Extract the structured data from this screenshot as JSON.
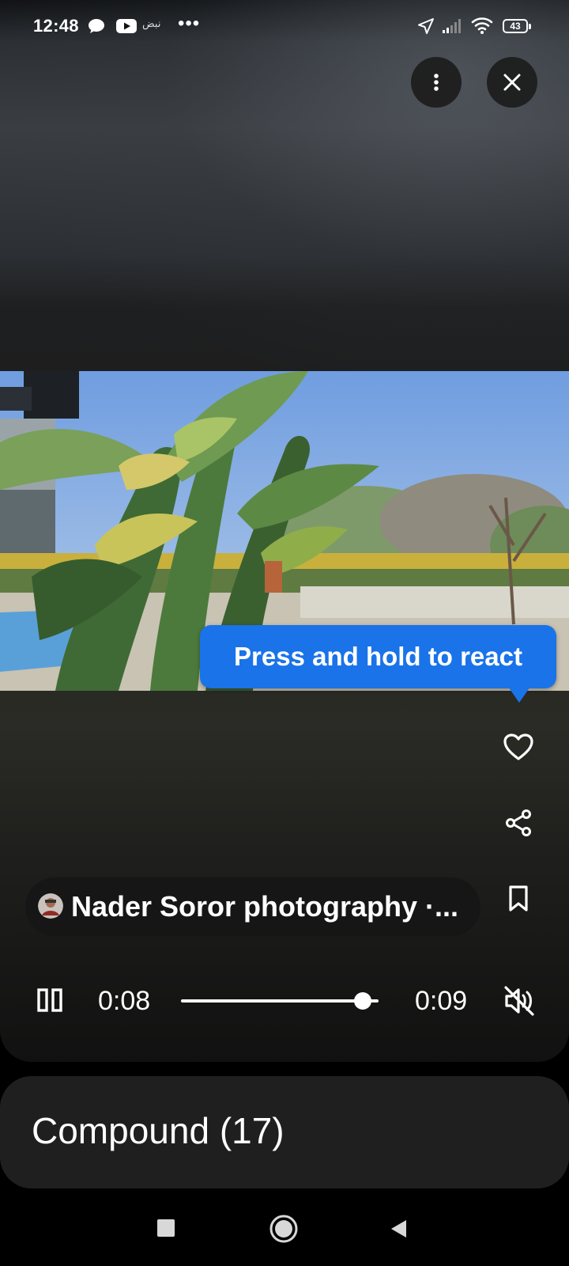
{
  "status_bar": {
    "time": "12:48",
    "arabic_label": "نبض",
    "more_dots": "•••",
    "battery_level": "43",
    "icons": [
      "message-icon",
      "youtube-icon",
      "location-icon",
      "signal-icon",
      "wifi-icon",
      "battery-icon"
    ]
  },
  "top_controls": {
    "icons": [
      "more-vertical-icon",
      "close-icon"
    ]
  },
  "tooltip": {
    "text": "Press and hold to react",
    "color": "#1a73e8"
  },
  "side_actions": [
    "heart-icon",
    "share-icon",
    "bookmark-icon"
  ],
  "channel": {
    "name": "Nader Soror photography ·..."
  },
  "playback": {
    "current_time": "0:08",
    "duration": "0:09",
    "progress": 0.92,
    "state": "playing",
    "muted": true
  },
  "card": {
    "title": "Compound (17)"
  },
  "nav": [
    "recents-button",
    "home-button",
    "back-button"
  ]
}
